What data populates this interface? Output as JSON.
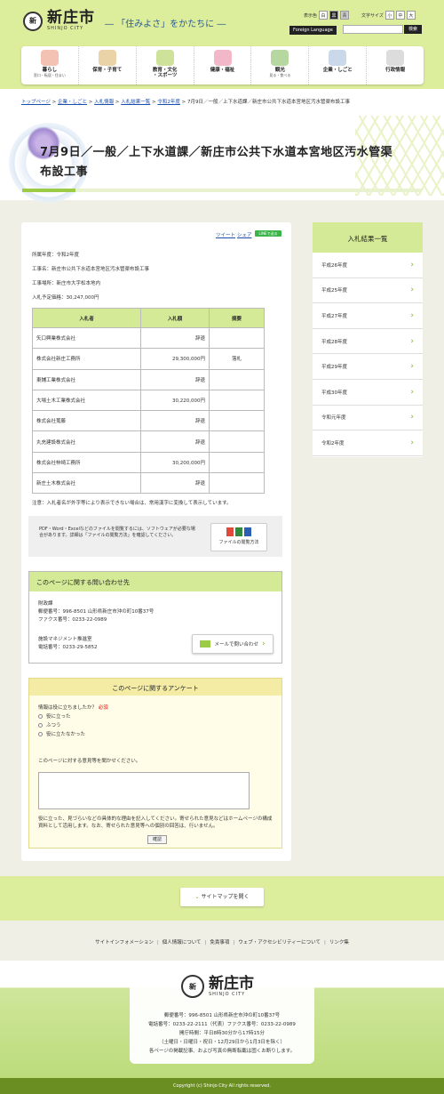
{
  "header": {
    "logo_mark": "新",
    "city_name": "新庄市",
    "city_en": "SHINJO CITY",
    "slogan": "― 「住みよさ」をかたちに ―",
    "color_label": "表示色",
    "color_opts": [
      "白",
      "黒",
      "青"
    ],
    "size_label": "文字サイズ",
    "size_opts": [
      "小",
      "中",
      "大"
    ],
    "foreign": "Foreign Language",
    "search_btn": "検索"
  },
  "nav": [
    {
      "label": "暮らし",
      "sub": "窓口・転居・住まい",
      "color": "#f3c2b3"
    },
    {
      "label": "保育・子育て",
      "sub": "",
      "color": "#e9d3a7"
    },
    {
      "label": "教育・文化",
      "sub": "・スポーツ",
      "color": "#cfe29a"
    },
    {
      "label": "健康・福祉",
      "sub": "",
      "color": "#f3b8c7"
    },
    {
      "label": "観光",
      "sub": "見る・食べる",
      "color": "#b7d7a0"
    },
    {
      "label": "企業・しごと",
      "sub": "",
      "color": "#c9d9ea"
    },
    {
      "label": "行政情報",
      "sub": "",
      "color": "#dcdcdc"
    }
  ],
  "breadcrumb": {
    "items": [
      "トップページ",
      "企業・しごと",
      "入札情報",
      "入札結果一覧",
      "令和2年度"
    ],
    "sep": " > ",
    "current": "7月9日／一般／上下水道課／新庄市公共下水道本宮地区汚水管渠布設工事"
  },
  "title": "7月9日／一般／上下水道課／新庄市公共下水道本宮地区汚水管渠布設工事",
  "share": {
    "tweet": "ツイート",
    "share": "シェア",
    "line": "LINEで送る"
  },
  "meta": {
    "year": "所属年度：令和2年度",
    "name": "工事名：新庄市公共下水道本宮地区汚水管渠布設工事",
    "place": "工事場所：新庄市大字松本地内",
    "price": "入札予定価格：30,247,000円"
  },
  "table": {
    "headers": [
      "入札者",
      "入札額",
      "摘要"
    ],
    "rows": [
      [
        "矢口興業株式会社",
        "辞退",
        ""
      ],
      [
        "株式会社新庄工務所",
        "29,300,000円",
        "落札"
      ],
      [
        "東鋪工業株式会社",
        "辞退",
        ""
      ],
      [
        "大場土木工業株式会社",
        "30,220,000円",
        ""
      ],
      [
        "株式会社蒐藤",
        "辞退",
        ""
      ],
      [
        "丸充建設株式会社",
        "辞退",
        ""
      ],
      [
        "株式会社柿崎工務所",
        "30,200,000円",
        ""
      ],
      [
        "新庄土木株式会社",
        "辞退",
        ""
      ]
    ]
  },
  "note": "注意：入札者名が外字等により表示できない場合は、常用漢字に変換して表示しています。",
  "pdf": {
    "text": "PDF・Word・Excelなどのファイルを閲覧するには、ソフトウェアが必要な場合があります。詳細は「ファイルの閲覧方法」を確認してください。",
    "button": "ファイルの閲覧方法"
  },
  "contact": {
    "heading": "このページに関する問い合わせ先",
    "dept1": "財政課",
    "zip1": "郵便番号：996-8501 山形県新庄市沖の町10番37号",
    "fax1": "ファクス番号：0233-22-0989",
    "dept2": "施設マネジメント推進室",
    "tel2": "電話番号：0233-29-5852",
    "mail": "メールで問い合わせ"
  },
  "survey": {
    "heading": "このページに関するアンケート",
    "question": "情報は役に立ちましたか？",
    "required": "必須",
    "options": [
      "役に立った",
      "ふつう",
      "役に立たなかった"
    ],
    "comment_label": "このページに対する意見等を聞かせください。",
    "note": "役に立った、見づらいなどの具体的な理由を記入してください。寄せられた意見などはホームページの構成資料として活用します。なお、寄せられた意見等への個別の回答は、行いません。",
    "confirm": "確認"
  },
  "sidebar": {
    "heading": "入札結果一覧",
    "items": [
      "平成26年度",
      "平成25年度",
      "平成27年度",
      "平成28年度",
      "平成29年度",
      "平成30年度",
      "令和元年度",
      "令和2年度"
    ]
  },
  "sitemap": "サイトマップを開く",
  "footer_links": [
    "サイトインフォメーション",
    "個人情報について",
    "免責事項",
    "ウェブ・アクセシビリティーについて",
    "リンク集"
  ],
  "footer": {
    "name": "新庄市",
    "en": "SHINJO CITY",
    "addr": "郵便番号：996-8501 山形県新庄市沖の町10番37号",
    "tel": "電話番号：0233-22-2111（代表）ファクス番号：0233-22-0989",
    "hours": "開庁時間：平日8時30分から17時15分",
    "closed": "（土曜日・日曜日・祝日・12月29日から1月3日を除く）",
    "rights": "各ページの掲載記事、および写真の無断転載は固くお断りします。",
    "copyright": "Copyright (c) Shinjo City All rights reserved."
  }
}
